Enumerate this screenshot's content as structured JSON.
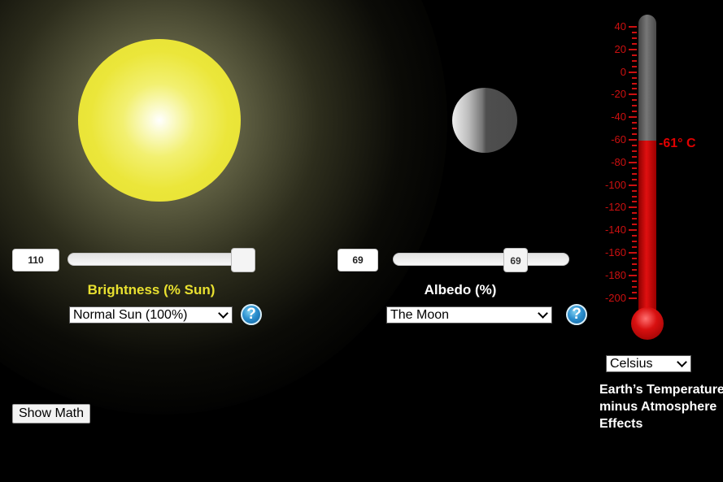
{
  "sun_control": {
    "value": "110",
    "slider_fraction": 0.96,
    "label": "Brightness (% Sun)",
    "label_color": "#e8e030",
    "preset": "Normal Sun (100%)",
    "help": "?"
  },
  "albedo_control": {
    "value": "69",
    "slider_value": "69",
    "slider_fraction": 0.69,
    "label": "Albedo (%)",
    "label_color": "#ffffff",
    "preset": "The Moon",
    "help": "?"
  },
  "show_math_label": "Show Math",
  "thermometer": {
    "ticks": [
      "40",
      "20",
      "0",
      "-20",
      "-40",
      "-60",
      "-80",
      "-100",
      "-120",
      "-140",
      "-160",
      "-180",
      "-200"
    ],
    "readout": "-61° C",
    "unit_select": "Celsius",
    "caption_lines": [
      "Earth’s Temperature",
      "minus Atmosphere",
      "Effects"
    ],
    "fill_color": "#d81010",
    "tick_color": "#cc1010"
  }
}
